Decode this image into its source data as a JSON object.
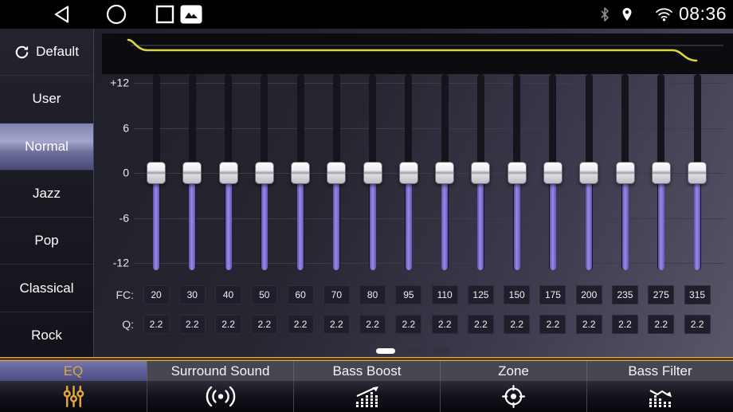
{
  "status_bar": {
    "time": "08:36"
  },
  "sidebar": {
    "items": [
      {
        "label": "Default",
        "icon": "refresh-icon"
      },
      {
        "label": "User"
      },
      {
        "label": "Normal",
        "selected": true
      },
      {
        "label": "Jazz"
      },
      {
        "label": "Pop"
      },
      {
        "label": "Classical"
      },
      {
        "label": "Rock"
      }
    ]
  },
  "eq": {
    "scale_labels": [
      "+12",
      "6",
      "0",
      "-6",
      "-12"
    ],
    "scale_values": [
      12,
      6,
      0,
      -6,
      -12
    ],
    "fc_label": "FC:",
    "q_label": "Q:",
    "bands": [
      {
        "fc": "20",
        "q": "2.2",
        "gain": 0
      },
      {
        "fc": "30",
        "q": "2.2",
        "gain": 0
      },
      {
        "fc": "40",
        "q": "2.2",
        "gain": 0
      },
      {
        "fc": "50",
        "q": "2.2",
        "gain": 0
      },
      {
        "fc": "60",
        "q": "2.2",
        "gain": 0
      },
      {
        "fc": "70",
        "q": "2.2",
        "gain": 0
      },
      {
        "fc": "80",
        "q": "2.2",
        "gain": 0
      },
      {
        "fc": "95",
        "q": "2.2",
        "gain": 0
      },
      {
        "fc": "110",
        "q": "2.2",
        "gain": 0
      },
      {
        "fc": "125",
        "q": "2.2",
        "gain": 0
      },
      {
        "fc": "150",
        "q": "2.2",
        "gain": 0
      },
      {
        "fc": "175",
        "q": "2.2",
        "gain": 0
      },
      {
        "fc": "200",
        "q": "2.2",
        "gain": 0
      },
      {
        "fc": "235",
        "q": "2.2",
        "gain": 0
      },
      {
        "fc": "275",
        "q": "2.2",
        "gain": 0
      },
      {
        "fc": "315",
        "q": "2.2",
        "gain": 0
      }
    ],
    "page_dots": {
      "count": 3,
      "active": 0
    }
  },
  "tabs": [
    {
      "label": "EQ",
      "icon": "eq-sliders-icon",
      "selected": true
    },
    {
      "label": "Surround Sound",
      "icon": "surround-sound-icon",
      "selected": false
    },
    {
      "label": "Bass Boost",
      "icon": "bass-boost-icon",
      "selected": false
    },
    {
      "label": "Zone",
      "icon": "zone-target-icon",
      "selected": false
    },
    {
      "label": "Bass Filter",
      "icon": "bass-filter-icon",
      "selected": false
    }
  ],
  "colors": {
    "accent_gold": "#e2a43c",
    "slider_purple": "#8172d6",
    "curve_yellow": "#ddd83e",
    "tab_selected_blue": "#5d5f99"
  }
}
